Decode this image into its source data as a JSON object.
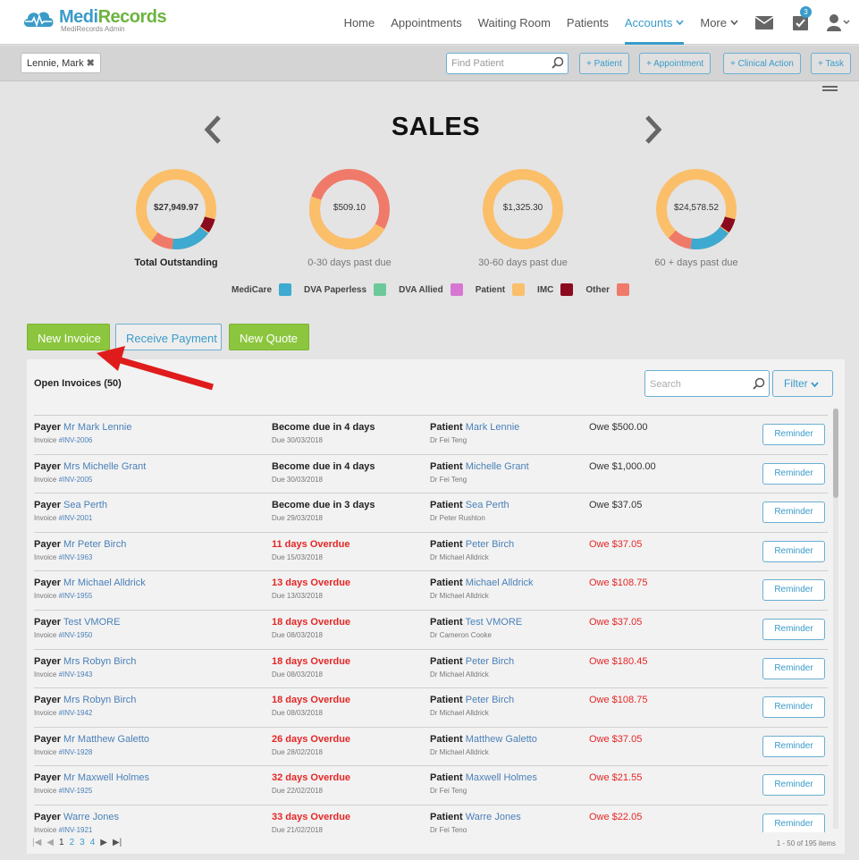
{
  "brand": {
    "name_part1": "Medi",
    "name_part2": "Records",
    "subtitle": "MediRecords Admin"
  },
  "nav": {
    "items": [
      {
        "label": "Home"
      },
      {
        "label": "Appointments"
      },
      {
        "label": "Waiting Room"
      },
      {
        "label": "Patients"
      },
      {
        "label": "Accounts",
        "active": true
      },
      {
        "label": "More"
      }
    ],
    "tasks_badge": "3"
  },
  "toolbar": {
    "patient_tag": "Lennie, Mark",
    "find_placeholder": "Find Patient",
    "buttons": [
      "+ Patient",
      "+ Appointment",
      "+ Clinical Action",
      "+ Task"
    ]
  },
  "sales": {
    "title": "SALES",
    "donuts": [
      {
        "value": "$27,949.97",
        "label": "Total Outstanding"
      },
      {
        "value": "$509.10",
        "label": "0-30 days past due"
      },
      {
        "value": "$1,325.30",
        "label": "30-60 days past due"
      },
      {
        "value": "$24,578.52",
        "label": "60 + days past due"
      }
    ],
    "legend": [
      {
        "label": "MediCare",
        "color": "#3ea9d1"
      },
      {
        "label": "DVA Paperless",
        "color": "#6cc99a"
      },
      {
        "label": "DVA Allied",
        "color": "#d876d4"
      },
      {
        "label": "Patient",
        "color": "#fbbf6a"
      },
      {
        "label": "IMC",
        "color": "#8a0a1e"
      },
      {
        "label": "Other",
        "color": "#f07a6a"
      }
    ]
  },
  "actions": {
    "new_invoice": "New Invoice",
    "receive_payment": "Receive Payment",
    "new_quote": "New Quote"
  },
  "invoices": {
    "title": "Open Invoices (50)",
    "search_placeholder": "Search",
    "filter_label": "Filter",
    "payer_label": "Payer",
    "patient_label": "Patient",
    "reminder_label": "Reminder",
    "rows": [
      {
        "payer": "Mr Mark Lennie",
        "invoice_prefix": "Invoice ",
        "invoice": "#INV-2006",
        "status": "Become due in 4 days",
        "overdue": false,
        "due": "Due 30/03/2018",
        "patient": "Mark Lennie",
        "doctor": "Dr Fei Teng",
        "owe": "Owe $500.00"
      },
      {
        "payer": "Mrs Michelle Grant",
        "invoice_prefix": "Invoice ",
        "invoice": "#INV-2005",
        "status": "Become due in 4 days",
        "overdue": false,
        "due": "Due 30/03/2018",
        "patient": "Michelle Grant",
        "doctor": "Dr Fei Teng",
        "owe": "Owe $1,000.00"
      },
      {
        "payer": "Sea Perth",
        "invoice_prefix": "Invoice ",
        "invoice": "#INV-2001",
        "status": "Become due in 3 days",
        "overdue": false,
        "due": "Due 29/03/2018",
        "patient": "Sea Perth",
        "doctor": "Dr Peter Rushton",
        "owe": "Owe $37.05"
      },
      {
        "payer": "Mr Peter Birch",
        "invoice_prefix": "Invoice ",
        "invoice": "#INV-1963",
        "status": "11 days Overdue",
        "overdue": true,
        "due": "Due 15/03/2018",
        "patient": "Peter Birch",
        "doctor": "Dr Michael Alldrick",
        "owe": "Owe $37.05"
      },
      {
        "payer": "Mr Michael Alldrick",
        "invoice_prefix": "Invoice ",
        "invoice": "#INV-1955",
        "status": "13 days Overdue",
        "overdue": true,
        "due": "Due 13/03/2018",
        "patient": "Michael Alldrick",
        "doctor": "Dr Michael Alldrick",
        "owe": "Owe $108.75"
      },
      {
        "payer": "Test VMORE",
        "invoice_prefix": "Invoice ",
        "invoice": "#INV-1950",
        "status": "18 days Overdue",
        "overdue": true,
        "due": "Due 08/03/2018",
        "patient": "Test VMORE",
        "doctor": "Dr Cameron Cooke",
        "owe": "Owe $37.05"
      },
      {
        "payer": "Mrs Robyn Birch",
        "invoice_prefix": "Invoice ",
        "invoice": "#INV-1943",
        "status": "18 days Overdue",
        "overdue": true,
        "due": "Due 08/03/2018",
        "patient": "Peter Birch",
        "doctor": "Dr Michael Alldrick",
        "owe": "Owe $180.45"
      },
      {
        "payer": "Mrs Robyn Birch",
        "invoice_prefix": "Invoice ",
        "invoice": "#INV-1942",
        "status": "18 days Overdue",
        "overdue": true,
        "due": "Due 08/03/2018",
        "patient": "Peter Birch",
        "doctor": "Dr Michael Alldrick",
        "owe": "Owe $108.75"
      },
      {
        "payer": "Mr Matthew Galetto",
        "invoice_prefix": "Invoice ",
        "invoice": "#INV-1928",
        "status": "26 days Overdue",
        "overdue": true,
        "due": "Due 28/02/2018",
        "patient": "Matthew Galetto",
        "doctor": "Dr Michael Alldrick",
        "owe": "Owe $37.05"
      },
      {
        "payer": "Mr Maxwell Holmes",
        "invoice_prefix": "Invoice ",
        "invoice": "#INV-1925",
        "status": "32 days Overdue",
        "overdue": true,
        "due": "Due 22/02/2018",
        "patient": "Maxwell Holmes",
        "doctor": "Dr Fei Teng",
        "owe": "Owe $21.55"
      },
      {
        "payer": "Warre Jones",
        "invoice_prefix": "Invoice ",
        "invoice": "#INV-1921",
        "status": "33 days Overdue",
        "overdue": true,
        "due": "Due 21/02/2018",
        "patient": "Warre Jones",
        "doctor": "Dr Fei Teng",
        "owe": "Owe $22.05"
      }
    ],
    "pager": {
      "pages": [
        "1",
        "2",
        "3",
        "4"
      ],
      "count": "1 - 50 of 195 items"
    }
  }
}
